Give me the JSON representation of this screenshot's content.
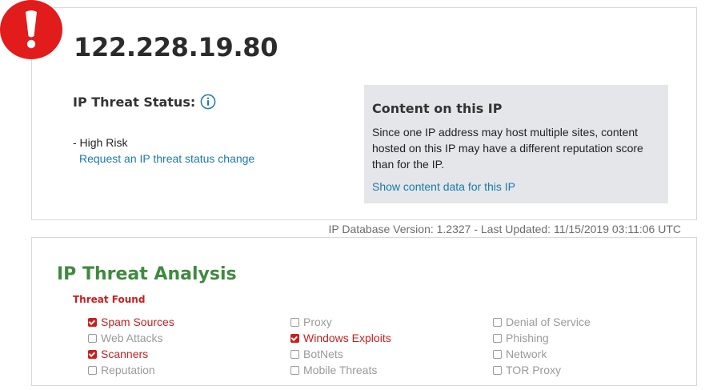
{
  "ip_address": "122.228.19.80",
  "status": {
    "label": "IP Threat Status:",
    "risk": "- High Risk",
    "change_link": "Request an IP threat status change"
  },
  "content_box": {
    "title": "Content on this IP",
    "description": "Since one IP address may host multiple sites, content hosted on this IP may have a different reputation score than for the IP.",
    "link": "Show content data for this IP"
  },
  "database_version": "IP Database Version: 1.2327 - Last Updated: 11/15/2019 03:11:06 UTC",
  "analysis": {
    "title": "IP Threat Analysis",
    "threat_found_label": "Threat Found",
    "columns": [
      [
        {
          "label": "Spam Sources",
          "checked": true
        },
        {
          "label": "Web Attacks",
          "checked": false
        },
        {
          "label": "Scanners",
          "checked": true
        },
        {
          "label": "Reputation",
          "checked": false
        }
      ],
      [
        {
          "label": "Proxy",
          "checked": false
        },
        {
          "label": "Windows Exploits",
          "checked": true
        },
        {
          "label": "BotNets",
          "checked": false
        },
        {
          "label": "Mobile Threats",
          "checked": false
        }
      ],
      [
        {
          "label": "Denial of Service",
          "checked": false
        },
        {
          "label": "Phishing",
          "checked": false
        },
        {
          "label": "Network",
          "checked": false
        },
        {
          "label": "TOR Proxy",
          "checked": false
        }
      ]
    ]
  },
  "colors": {
    "alert_red": "#e21b1b",
    "link_blue": "#1a7aa8",
    "analysis_green": "#3f8a3f",
    "threat_red": "#c81f1f"
  }
}
